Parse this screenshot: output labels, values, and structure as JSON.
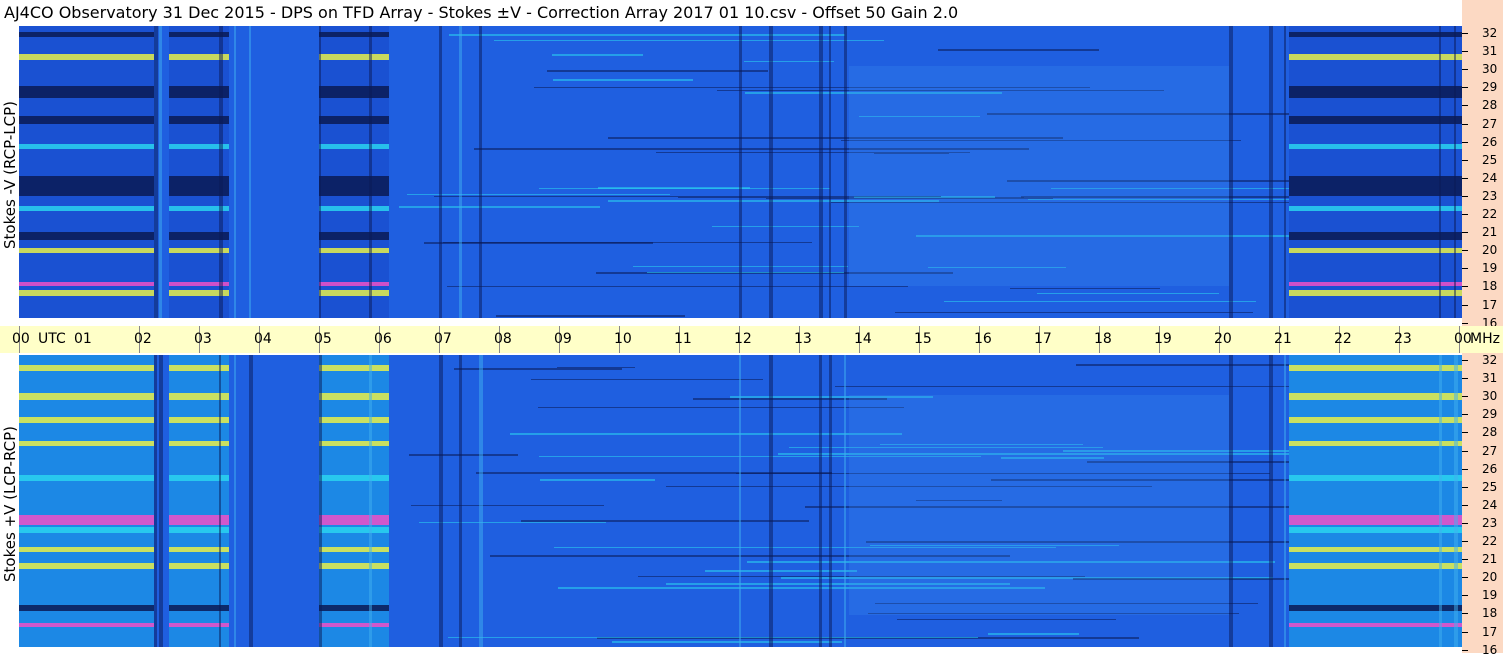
{
  "title": "AJ4CO Observatory  31 Dec 2015  -  DPS on TFD Array  -  Stokes ±V  -  Correction Array 2017 01 10.csv  -  Offset 50  Gain 2.0",
  "panels": {
    "top": {
      "ylabel": "Stokes -V (RCP-LCP)"
    },
    "bottom": {
      "ylabel": "Stokes +V (LCP-RCP)"
    }
  },
  "time_axis": {
    "labels": [
      "00",
      "UTC",
      "01",
      "02",
      "03",
      "04",
      "05",
      "06",
      "07",
      "08",
      "09",
      "10",
      "11",
      "12",
      "13",
      "14",
      "15",
      "16",
      "17",
      "18",
      "19",
      "20",
      "21",
      "22",
      "23",
      "00",
      "MHz"
    ]
  },
  "freq_axis": {
    "labels": [
      "32",
      "31",
      "30",
      "29",
      "28",
      "27",
      "26",
      "25",
      "24",
      "23",
      "22",
      "21",
      "20",
      "19",
      "18",
      "17",
      "16"
    ]
  },
  "colors": {
    "background_blue": "#1f5fe0",
    "dark_band": "#0a1a55",
    "cyan_band": "#2ad4f0",
    "yellow_band": "#e8f04a",
    "magenta_band": "#f050c8",
    "time_bar": "#ffffc8",
    "freq_bar": "#fcd9c3"
  }
}
